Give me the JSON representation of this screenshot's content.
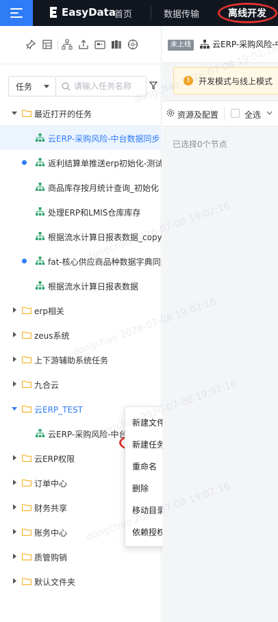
{
  "topbar": {
    "logo_text": "EasyData",
    "nav": [
      "首页",
      "数据传输",
      "离线开发"
    ],
    "active_nav": "离线开发"
  },
  "left": {
    "toolbar_icons": [
      "pin-icon",
      "layout-icon",
      "hierarchy-icon",
      "upload-icon",
      "image-icon",
      "columns-icon",
      "compass-icon"
    ],
    "filter_select": "任务",
    "search_placeholder": "请输入任务名称",
    "tree": [
      {
        "label": "最近打开的任务",
        "type": "folder",
        "expanded": true,
        "level": 0
      },
      {
        "label": "云ERP-采购风险-中台数据同步",
        "type": "task",
        "level": 1,
        "selected": true
      },
      {
        "label": "返利结算单推送erp初始化-测试",
        "type": "task",
        "level": 1,
        "dot": true
      },
      {
        "label": "商品库存按月统计查询_初始化",
        "type": "task",
        "level": 1
      },
      {
        "label": "处理ERP和LMIS仓库库存",
        "type": "task",
        "level": 1
      },
      {
        "label": "根据流水计算日报表数据_copy",
        "type": "task",
        "level": 1
      },
      {
        "label": "fat-核心供应商品种数据字典同步",
        "type": "task",
        "level": 1,
        "dot": true
      },
      {
        "label": "根据流水计算日报表数据",
        "type": "task",
        "level": 1
      },
      {
        "label": "erp相关",
        "type": "folder",
        "level": 0
      },
      {
        "label": "zeus系统",
        "type": "folder",
        "level": 0
      },
      {
        "label": "上下游辅助系统任务",
        "type": "folder",
        "level": 0
      },
      {
        "label": "九合云",
        "type": "folder",
        "level": 0
      },
      {
        "label": "云ERP_TEST",
        "type": "folder",
        "level": 0,
        "expanded": true,
        "highlight": true
      },
      {
        "label": "云ERP-采购风险-中台",
        "type": "task",
        "level": 1
      },
      {
        "label": "云ERP权限",
        "type": "folder",
        "level": 0
      },
      {
        "label": "订单中心",
        "type": "folder",
        "level": 0
      },
      {
        "label": "财务共享",
        "type": "folder",
        "level": 0
      },
      {
        "label": "账务中心",
        "type": "folder",
        "level": 0
      },
      {
        "label": "质管购销",
        "type": "folder",
        "level": 0
      },
      {
        "label": "默认文件夹",
        "type": "folder",
        "level": 0
      }
    ]
  },
  "context_menu": {
    "items": [
      "新建文件夹",
      "新建任务",
      "重命名",
      "删除",
      "移动目录",
      "依赖授权"
    ]
  },
  "right": {
    "status_tag": "未上线",
    "flow_title": "云ERP-采购风险-中",
    "notice": "开发模式与线上模式",
    "resource_config": "资源及配置",
    "select_all": "全选",
    "selected_count": "已选择0个节点"
  },
  "watermark": "dongchao 2026-07-08 19:02:16",
  "colors": {
    "accent": "#2f7cf6",
    "topbar": "#12161f",
    "folder": "#f7b733",
    "task_icon": "#2aa36b",
    "annotation": "#e0312e"
  }
}
